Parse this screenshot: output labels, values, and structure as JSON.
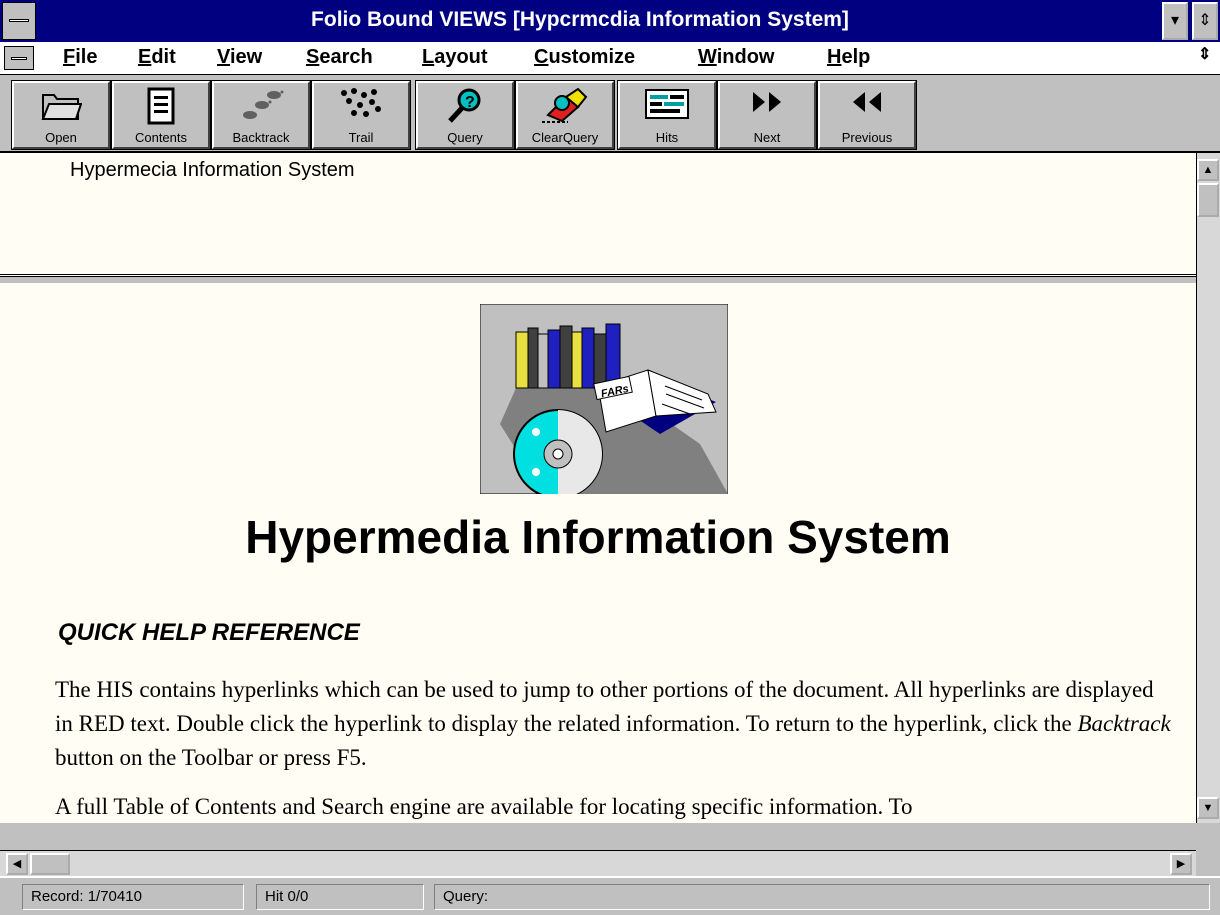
{
  "window": {
    "title": "Folio Bound VIEWS   [Hypcrmcdia Information System]"
  },
  "menu": [
    {
      "label": "File",
      "accel": "F",
      "rest": "ile"
    },
    {
      "label": "Edit",
      "accel": "E",
      "rest": "dit"
    },
    {
      "label": "View",
      "accel": "V",
      "rest": "iew"
    },
    {
      "label": "Search",
      "accel": "S",
      "rest": "earch"
    },
    {
      "label": "Layout",
      "accel": "L",
      "rest": "ayout"
    },
    {
      "label": "Customize",
      "accel": "C",
      "rest": "ustomize"
    },
    {
      "label": "Window",
      "accel": "W",
      "rest": "indow"
    },
    {
      "label": "Help",
      "accel": "H",
      "rest": "elp"
    }
  ],
  "toolbar": [
    {
      "label": "Open",
      "icon": "folder-icon"
    },
    {
      "label": "Contents",
      "icon": "contents-icon"
    },
    {
      "label": "Backtrack",
      "icon": "footprints-icon"
    },
    {
      "label": "Trail",
      "icon": "trail-icon"
    },
    {
      "label": "Query",
      "icon": "query-icon"
    },
    {
      "label": "ClearQuery",
      "icon": "eraser-icon"
    },
    {
      "label": "Hits",
      "icon": "hits-icon"
    },
    {
      "label": "Next",
      "icon": "next-icon"
    },
    {
      "label": "Previous",
      "icon": "previous-icon"
    }
  ],
  "top_pane": {
    "text": "Hypermecia Information System"
  },
  "document": {
    "logo_text": "FARs",
    "heading": "Hypermedia Information System",
    "subheading": "QUICK HELP REFERENCE",
    "para1_a": "The HIS contains hyperlinks which can be used to jump to other portions of the document.  All hyperlinks are displayed in RED text.  Double click the hyperlink to display the related information.  To return to the hyperlink, click the ",
    "para1_em": "Backtrack",
    "para1_b": " button on the Toolbar or press F5.",
    "para2": "A full Table of Contents and Search engine are available for locating specific information.  To"
  },
  "status": {
    "record": "Record: 1/70410",
    "hit": "Hit 0/0",
    "query": "Query:"
  },
  "colors": {
    "titlebar": "#000080",
    "document_bg": "#fffdf4",
    "chrome": "#c0c0c0"
  }
}
